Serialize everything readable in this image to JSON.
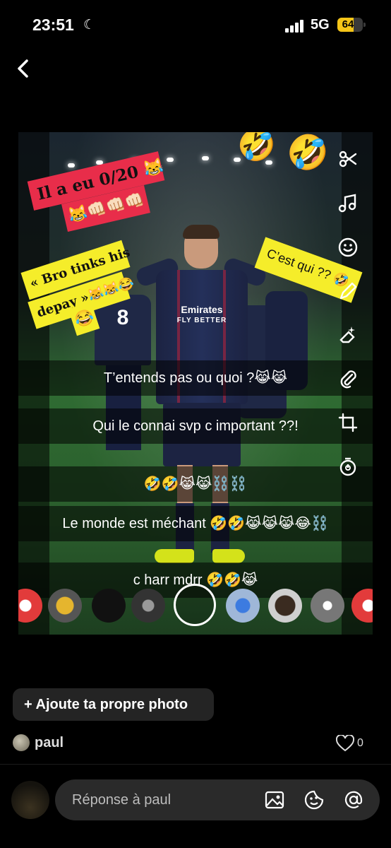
{
  "status_bar": {
    "time": "23:51",
    "network": "5G",
    "battery": "64",
    "battery_level": 0.64,
    "icons": [
      "moon-icon",
      "signal-icon",
      "battery-icon"
    ]
  },
  "nav": {
    "back_icon": "chevron-left-icon"
  },
  "story": {
    "stickers": {
      "sticker_1_line1": "Il a eu 0/20 😹",
      "sticker_1_line2": "😹👊🏻👊🏻👊🏻",
      "sticker_2_line1": "« Bro tinks his",
      "sticker_2_line2": "depay »😹😹😂",
      "sticker_2_line3": "😂",
      "sticker_3": "C’est qui ?? 🤣",
      "laugh_1": "🤣",
      "laugh_2": "🤣"
    },
    "jersey": {
      "sponsor": "Emirates",
      "sponsor_line2": "FLY BETTER",
      "number": "8"
    },
    "captions": [
      "T’entends pas ou quoi ?😹😹",
      "Qui le connai svp c important ??!",
      "🤣🤣😹😹⛓️⛓️",
      "Le monde est méchant 🤣🤣😹😹😹😂⛓️",
      "c harr mdrr 🤣🤣😹"
    ],
    "tools": [
      "scissors-icon",
      "music-icon",
      "smiley-icon",
      "pencil-icon",
      "eraser-icon",
      "paperclip-icon",
      "crop-icon",
      "timer-icon"
    ],
    "lenses": [
      "map-pin-lens",
      "location-lens",
      "dark-lens",
      "emblem-lens",
      "shutter-button",
      "maps-lens",
      "portrait-lens",
      "pin-lens",
      "map-pin-lens-2"
    ]
  },
  "actions": {
    "add_photo": "+ Ajoute ta propre photo"
  },
  "author": {
    "name": "paul"
  },
  "likes": {
    "count": "0"
  },
  "reply": {
    "placeholder": "Réponse à paul",
    "icons": [
      "image-icon",
      "sticker-icon",
      "mention-icon"
    ]
  }
}
